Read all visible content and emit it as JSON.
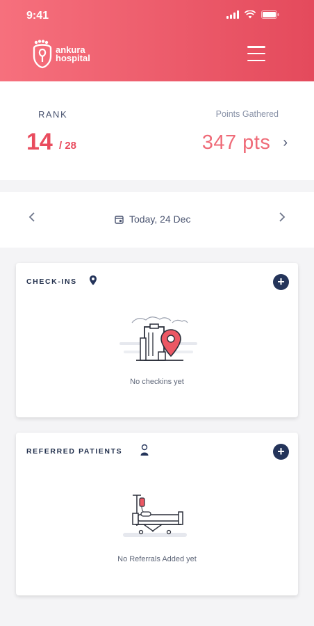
{
  "status_bar": {
    "time": "9:41"
  },
  "header": {
    "logo_line1": "ankura",
    "logo_line2": "hospital",
    "menu_icon": "hamburger-icon"
  },
  "stats": {
    "rank_label": "RANK",
    "rank_value": "14",
    "rank_total": "/ 28",
    "points_label": "Points Gathered",
    "points_value": "347 pts"
  },
  "date_nav": {
    "date_label": "Today, 24 Dec",
    "prev_icon": "chevron-left-icon",
    "next_icon": "chevron-right-icon"
  },
  "checkins": {
    "title": "CHECK-INS",
    "empty_text": "No checkins yet"
  },
  "referrals": {
    "title": "REFERRED PATIENTS",
    "empty_text": "No Referrals Added yet"
  },
  "colors": {
    "brand_start": "#f6707d",
    "brand_end": "#e44a5c",
    "accent_red": "#e94c5e",
    "navy": "#24345a"
  }
}
